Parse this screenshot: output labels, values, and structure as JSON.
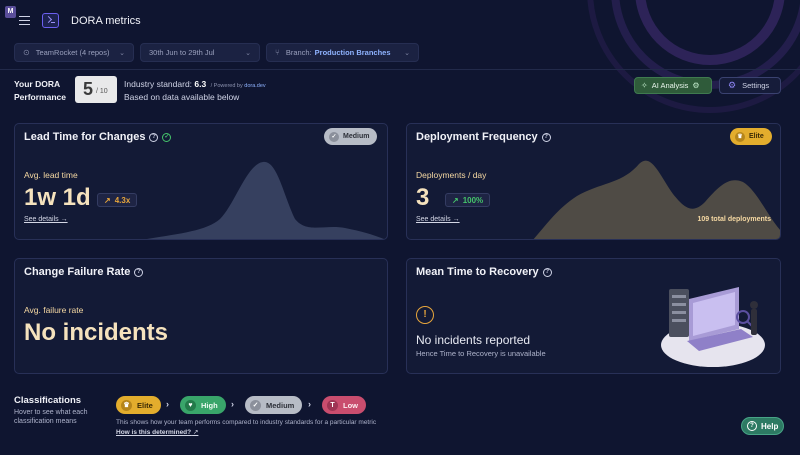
{
  "header": {
    "badge": "M",
    "title": "DORA metrics"
  },
  "filters": {
    "team": "TeamRocket (4 repos)",
    "date_range": "30th Jun to 29th Jul",
    "branch_label": "Branch:",
    "branch_value": "Production Branches"
  },
  "summary": {
    "your_dora_line1": "Your DORA",
    "your_dora_line2": "Performance",
    "score": "5",
    "score_den": "/ 10",
    "industry_label": "Industry standard:",
    "industry_value": "6.3",
    "powered_by": "/ Powered by",
    "powered_link": "dora.dev",
    "based_on": "Based on data available below",
    "ai_button": "AI Analysis",
    "settings_button": "Settings"
  },
  "cards": {
    "lead_time": {
      "title": "Lead Time for Changes",
      "level": "Medium",
      "label": "Avg. lead time",
      "value": "1w 1d",
      "trend": "4.3x",
      "see_details": "See details →"
    },
    "deploy_freq": {
      "title": "Deployment Frequency",
      "level": "Elite",
      "label": "Deployments / day",
      "value": "3",
      "trend": "100%",
      "see_details": "See details →",
      "total": "109 total deployments"
    },
    "cfr": {
      "title": "Change Failure Rate",
      "label": "Avg. failure rate",
      "value": "No incidents"
    },
    "mttr": {
      "title": "Mean Time to Recovery",
      "value": "No incidents reported",
      "sub": "Hence Time to Recovery is unavailable"
    }
  },
  "classifications": {
    "title": "Classifications",
    "subtitle": "Hover to see what each classification means",
    "levels": [
      "Elite",
      "High",
      "Medium",
      "Low"
    ],
    "note": "This shows how your team performs compared to industry standards for a particular metric",
    "link": "How is this determined?"
  },
  "help": {
    "label": "Help"
  },
  "colors": {
    "background": "#0f1530",
    "accent": "#6b5ff0",
    "elite": "#e3ad2d",
    "high": "#39a56a",
    "medium": "#b7bcc6",
    "low": "#c94d6e"
  }
}
